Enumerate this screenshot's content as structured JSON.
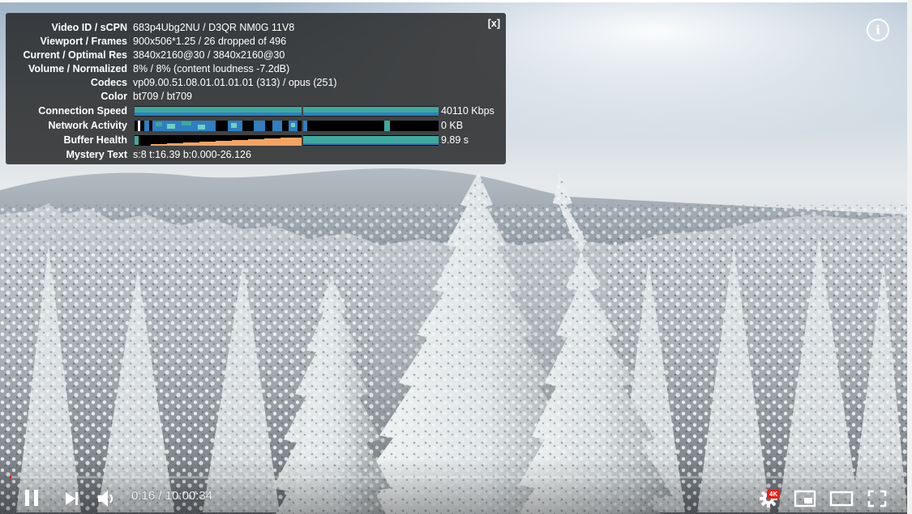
{
  "stats_panel": {
    "close_label": "[x]",
    "rows": [
      {
        "label": "Video ID / sCPN",
        "value": "683p4Ubg2NU / D3QR NM0G 11V8"
      },
      {
        "label": "Viewport / Frames",
        "value": "900x506*1.25 / 26 dropped of 496"
      },
      {
        "label": "Current / Optimal Res",
        "value": "3840x2160@30 / 3840x2160@30"
      },
      {
        "label": "Volume / Normalized",
        "value": "8% / 8% (content loudness -7.2dB)"
      },
      {
        "label": "Codecs",
        "value": "vp09.00.51.08.01.01.01.01 (313) / opus (251)"
      },
      {
        "label": "Color",
        "value": "bt709 / bt709"
      }
    ],
    "graph_rows": [
      {
        "label": "Connection Speed",
        "value": "40110 Kbps"
      },
      {
        "label": "Network Activity",
        "value": "0 KB"
      },
      {
        "label": "Buffer Health",
        "value": "9.89 s"
      }
    ],
    "mystery": {
      "label": "Mystery Text",
      "value": "s:8 t:16.39 b:0.000-26.126"
    }
  },
  "controls": {
    "time_current": "0:16",
    "time_separator": " / ",
    "time_total": "10:00:34",
    "progress_fraction": 0.00044,
    "quality_badge": "4K",
    "icons": {
      "play_pause": "pause-icon",
      "next": "next-icon",
      "volume": "volume-icon",
      "settings": "gear-icon",
      "miniplayer": "miniplayer-icon",
      "theater": "theater-mode-icon",
      "fullscreen": "fullscreen-icon",
      "info": "info-icon"
    }
  },
  "colors": {
    "stats_bg": "#1c1c1c",
    "graph_teal": "#3ea99f",
    "graph_blue": "#2f7fc1",
    "graph_orange": "#f4a460",
    "progress_red": "#ff0000"
  }
}
